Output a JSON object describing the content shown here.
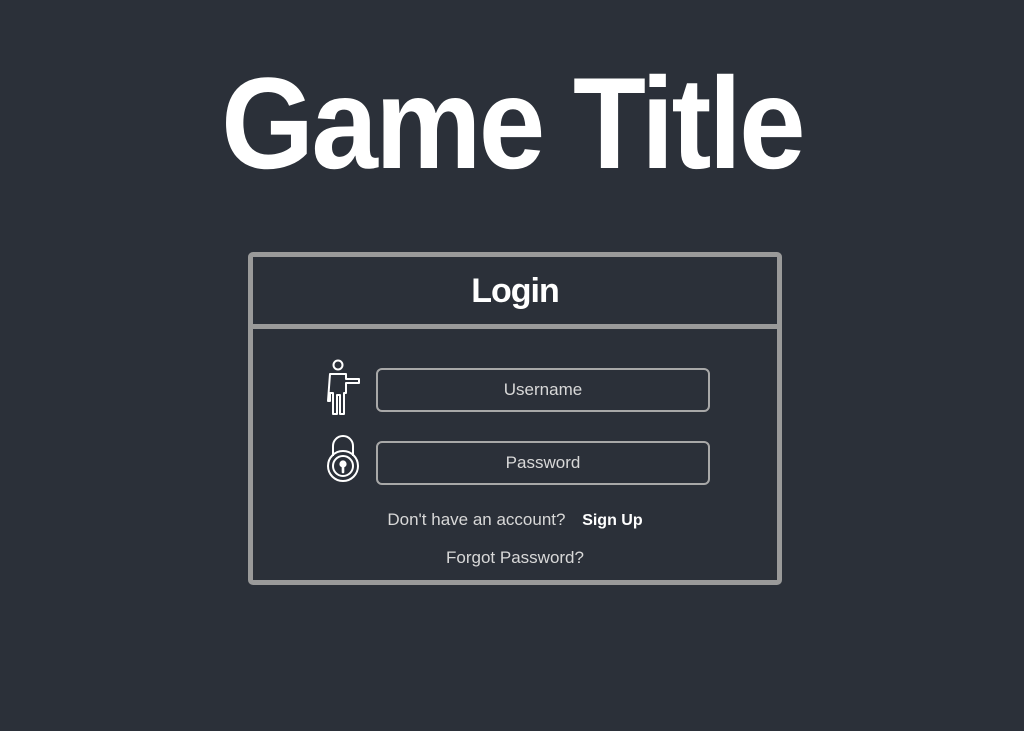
{
  "header": {
    "game_title": "Game Title"
  },
  "login": {
    "title": "Login",
    "username": {
      "placeholder": "Username",
      "value": "",
      "icon": "person-pointing-icon"
    },
    "password": {
      "placeholder": "Password",
      "value": "",
      "icon": "padlock-icon"
    },
    "signup_prompt": "Don't have an account?",
    "signup_label": "Sign Up",
    "forgot_label": "Forgot Password?"
  },
  "colors": {
    "background": "#2b3039",
    "panel_border": "#9a9a9a",
    "field_border": "#a8a8a8",
    "text_primary": "#ffffff",
    "text_secondary": "#d8d8d8"
  }
}
